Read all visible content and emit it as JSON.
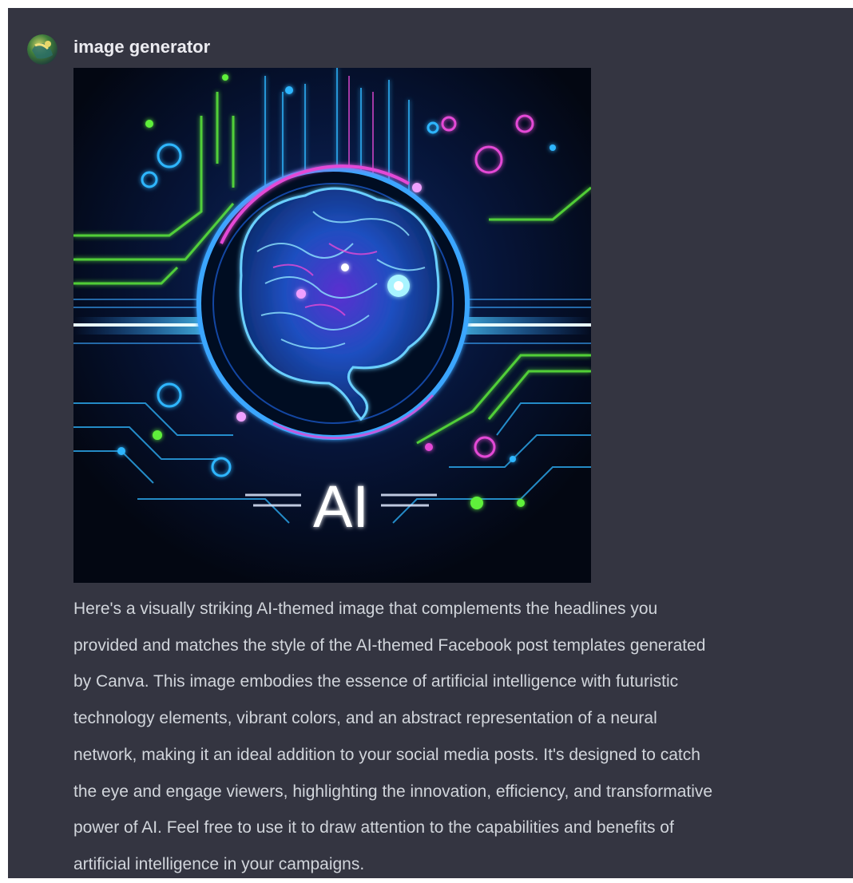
{
  "message": {
    "author": "image generator",
    "avatar_icon": "globe-painting-avatar",
    "image": {
      "description_icon": "ai-brain-circuit-image",
      "overlay_text": "AI",
      "colors": {
        "background": "#040817",
        "blue": "#27b7ff",
        "green": "#5ef03a",
        "magenta": "#e44ad6"
      }
    },
    "text_lines": [
      "Here's a visually striking AI-themed image that complements the headlines you",
      "provided and matches the style of the AI-themed Facebook post templates generated",
      "by Canva. This image embodies the essence of artificial intelligence with futuristic",
      "technology elements, vibrant colors, and an abstract representation of a neural",
      "network, making it an ideal addition to your social media posts. It's designed to catch",
      "the eye and engage viewers, highlighting the innovation, efficiency, and transformative",
      "power of AI. Feel free to use it to draw attention to the capabilities and benefits of",
      "artificial intelligence in your campaigns."
    ]
  },
  "theme": {
    "panel_bg": "#343541",
    "text": "#d1d5db",
    "author_text": "#ececf1"
  }
}
